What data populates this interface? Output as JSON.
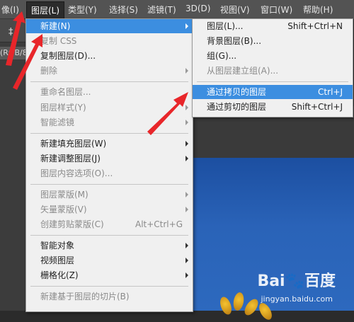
{
  "menubar": {
    "items": [
      {
        "label": "像(I)"
      },
      {
        "label": "图层(L)"
      },
      {
        "label": "类型(Y)"
      },
      {
        "label": "选择(S)"
      },
      {
        "label": "滤镜(T)"
      },
      {
        "label": "3D(D)"
      },
      {
        "label": "视图(V)"
      },
      {
        "label": "窗口(W)"
      },
      {
        "label": "帮助(H)"
      }
    ],
    "active_index": 1
  },
  "document": {
    "tab_text": "(RGB/8",
    "tool_glyph": "‡",
    "tool_glyph2": "\""
  },
  "main_menu": {
    "items": [
      {
        "label": "新建(N)",
        "highlighted": true,
        "submenu": true
      },
      {
        "label": "复制 CSS",
        "disabled": true
      },
      {
        "label": "复制图层(D)..."
      },
      {
        "label": "删除",
        "disabled": true,
        "submenu": true
      },
      {
        "label": "重命名图层...",
        "disabled": true
      },
      {
        "label": "图层样式(Y)",
        "disabled": true,
        "submenu": true
      },
      {
        "label": "智能滤镜",
        "disabled": true,
        "submenu": true
      },
      {
        "label": "新建填充图层(W)",
        "submenu": true
      },
      {
        "label": "新建调整图层(J)",
        "submenu": true
      },
      {
        "label": "图层内容选项(O)...",
        "disabled": true
      },
      {
        "label": "图层蒙版(M)",
        "disabled": true,
        "submenu": true
      },
      {
        "label": "矢量蒙版(V)",
        "disabled": true,
        "submenu": true
      },
      {
        "label": "创建剪贴蒙版(C)",
        "disabled": true,
        "shortcut": "Alt+Ctrl+G"
      },
      {
        "label": "智能对象",
        "submenu": true
      },
      {
        "label": "视频图层",
        "submenu": true
      },
      {
        "label": "栅格化(Z)",
        "submenu": true
      },
      {
        "label": "新建基于图层的切片(B)",
        "disabled": true
      }
    ]
  },
  "sub_menu": {
    "items": [
      {
        "label": "图层(L)...",
        "shortcut": "Shift+Ctrl+N"
      },
      {
        "label": "背景图层(B)..."
      },
      {
        "label": "组(G)..."
      },
      {
        "label": "从图层建立组(A)...",
        "disabled": true
      },
      {
        "label": "通过拷贝的图层",
        "shortcut": "Ctrl+J",
        "highlighted": true
      },
      {
        "label": "通过剪切的图层",
        "shortcut": "Shift+Ctrl+J"
      }
    ]
  },
  "watermark": {
    "logo": "Bai🐾百度",
    "sub": "jingyan.baidu.com"
  },
  "colors": {
    "highlight": "#3c8ee0",
    "annotation": "#e8262a",
    "menubar": "#535353"
  }
}
